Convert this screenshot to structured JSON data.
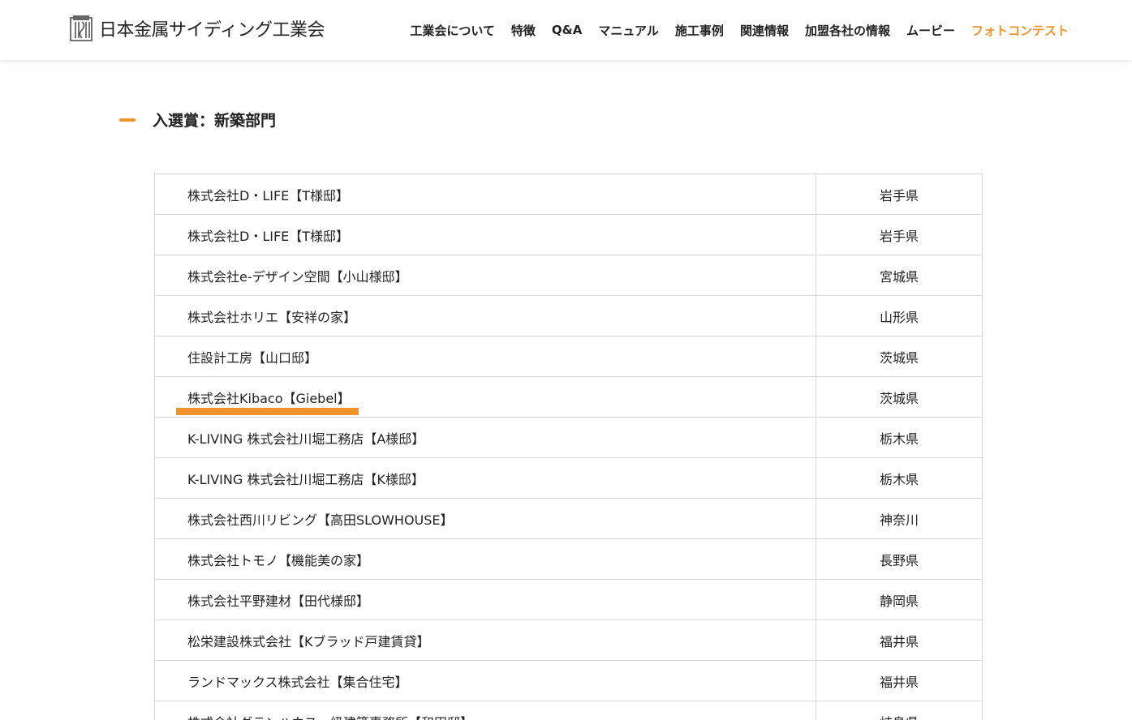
{
  "header": {
    "logo_text": "日本金属サイディング工業会",
    "nav": [
      {
        "label": "工業会について"
      },
      {
        "label": "特徴"
      },
      {
        "label": "Q&A"
      },
      {
        "label": "マニュアル"
      },
      {
        "label": "施工事例"
      },
      {
        "label": "関連情報"
      },
      {
        "label": "加盟各社の情報"
      },
      {
        "label": "ムービー"
      },
      {
        "label": "フォトコンテスト",
        "active": true
      }
    ],
    "accent_color": "#f0932b"
  },
  "section": {
    "title": "入選賞：新築部門"
  },
  "table": {
    "rows": [
      {
        "name": "株式会社D・LIFE【T様邸】",
        "pref": "岩手県"
      },
      {
        "name": "株式会社D・LIFE【T様邸】",
        "pref": "岩手県"
      },
      {
        "name": "株式会社e-デザイン空間【小山様邸】",
        "pref": "宮城県"
      },
      {
        "name": "株式会社ホリエ【安祥の家】",
        "pref": "山形県"
      },
      {
        "name": "住設計工房【山口邸】",
        "pref": "茨城県"
      },
      {
        "name": "株式会社Kibaco【Giebel】",
        "pref": "茨城県",
        "highlighted": true
      },
      {
        "name": "K-LIVING 株式会社川堀工務店【A様邸】",
        "pref": "栃木県"
      },
      {
        "name": "K-LIVING 株式会社川堀工務店【K様邸】",
        "pref": "栃木県"
      },
      {
        "name": "株式会社西川リビング【高田SLOWHOUSE】",
        "pref": "神奈川"
      },
      {
        "name": "株式会社トモノ【機能美の家】",
        "pref": "長野県"
      },
      {
        "name": "株式会社平野建材【田代様邸】",
        "pref": "静岡県"
      },
      {
        "name": "松栄建設株式会社【Kブラッド戸建賃貸】",
        "pref": "福井県"
      },
      {
        "name": "ランドマックス株式会社【集合住宅】",
        "pref": "福井県"
      },
      {
        "name": "株式会社グランハウス一級建築事務所【和田邸】",
        "pref": "岐阜県"
      }
    ]
  }
}
